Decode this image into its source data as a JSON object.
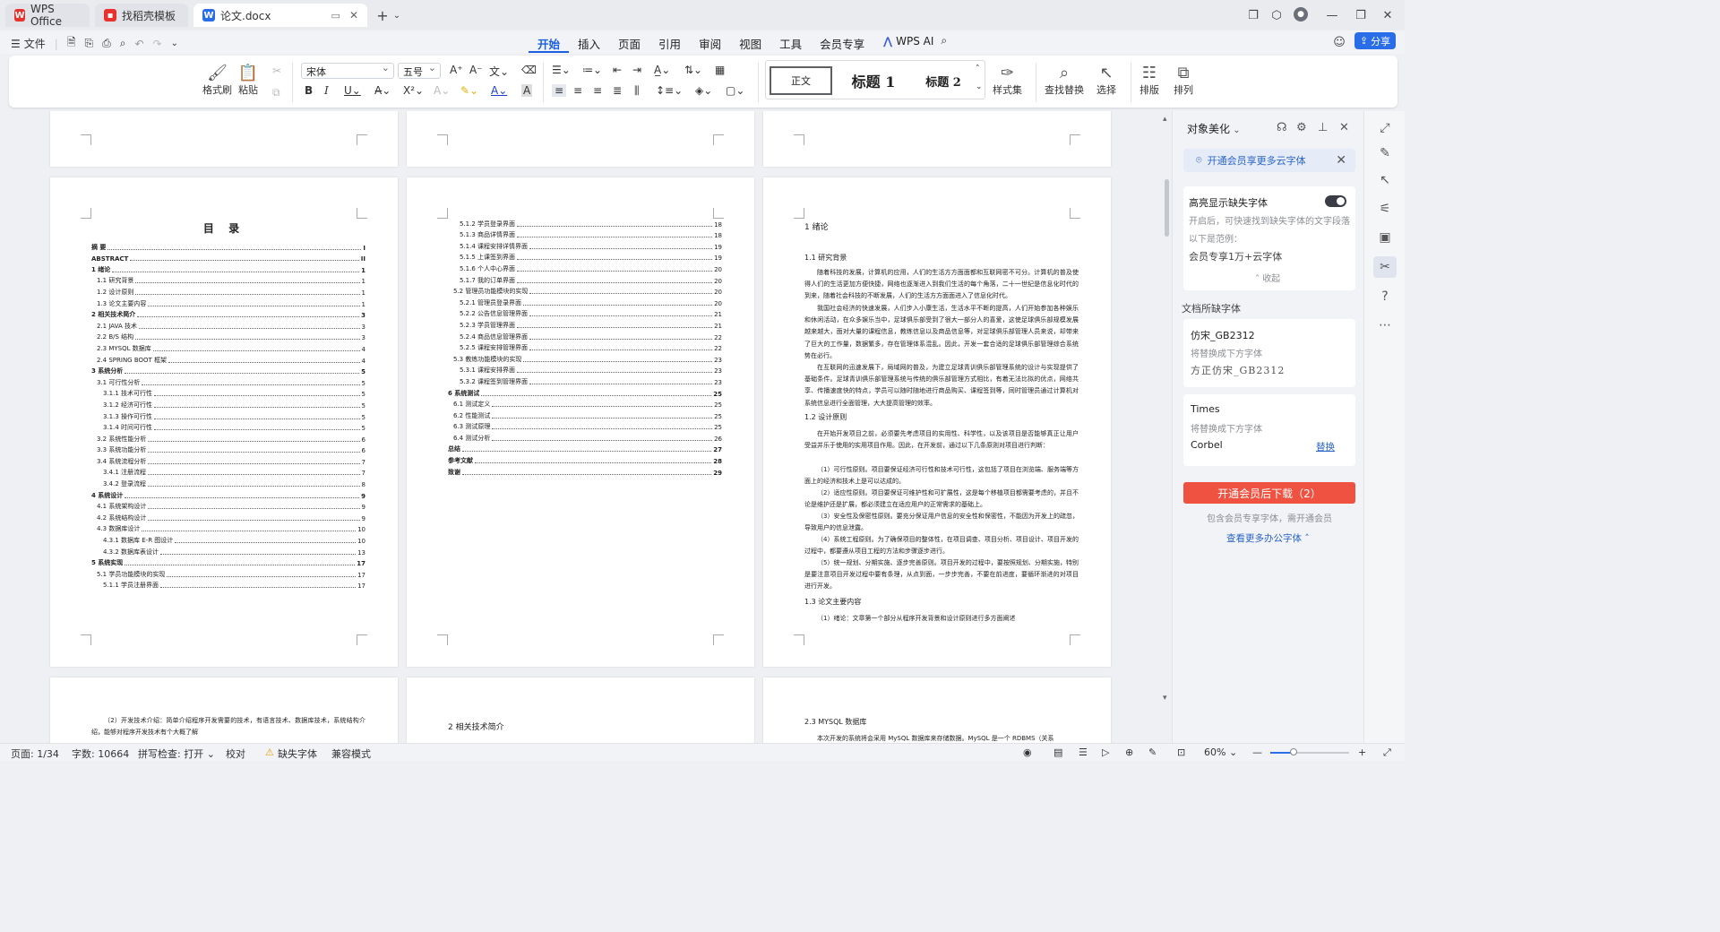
{
  "tabs": [
    {
      "label": "WPS Office",
      "icon": "wps-logo-icon"
    },
    {
      "label": "找稻壳模板",
      "icon": "docer-logo-icon"
    },
    {
      "label": "论文.docx",
      "icon": "writer-doc-icon"
    }
  ],
  "menu": {
    "file": "文件",
    "tabs": [
      "开始",
      "插入",
      "页面",
      "引用",
      "审阅",
      "视图",
      "工具",
      "会员专享"
    ],
    "active_tab": "开始",
    "wps_ai": "WPS AI",
    "share": "分享"
  },
  "ribbon": {
    "format_painter": "格式刷",
    "paste": "粘贴",
    "font_name": "宋体",
    "font_size": "五号",
    "style_normal": "正文",
    "style_h1": "标题 1",
    "style_h2": "标题 2",
    "style_set": "样式集",
    "find_replace": "查找替换",
    "select": "选择",
    "layout": "排版",
    "arrange": "排列"
  },
  "toc_page1": {
    "title": "目 录",
    "rows": [
      {
        "level": 1,
        "label": "摘 要",
        "page": "I"
      },
      {
        "level": 1,
        "label": "ABSTRACT",
        "page": "II"
      },
      {
        "level": 1,
        "label": "1 绪论",
        "page": "1"
      },
      {
        "level": 2,
        "label": "1.1 研究背景",
        "page": "1"
      },
      {
        "level": 2,
        "label": "1.2 设计原则",
        "page": "1"
      },
      {
        "level": 2,
        "label": "1.3 论文主要内容",
        "page": "1"
      },
      {
        "level": 1,
        "label": "2 相关技术简介",
        "page": "3"
      },
      {
        "level": 2,
        "label": "2.1 JAVA 技术",
        "page": "3"
      },
      {
        "level": 2,
        "label": "2.2 B/S 结构",
        "page": "3"
      },
      {
        "level": 2,
        "label": "2.3 MYSQL 数据库",
        "page": "4"
      },
      {
        "level": 2,
        "label": "2.4 SPRING BOOT 框架",
        "page": "4"
      },
      {
        "level": 1,
        "label": "3 系统分析",
        "page": "5"
      },
      {
        "level": 2,
        "label": "3.1 可行性分析",
        "page": "5"
      },
      {
        "level": 3,
        "label": "3.1.1 技术可行性",
        "page": "5"
      },
      {
        "level": 3,
        "label": "3.1.2 经济可行性",
        "page": "5"
      },
      {
        "level": 3,
        "label": "3.1.3 操作可行性",
        "page": "5"
      },
      {
        "level": 3,
        "label": "3.1.4 时间可行性",
        "page": "5"
      },
      {
        "level": 2,
        "label": "3.2 系统性能分析",
        "page": "6"
      },
      {
        "level": 2,
        "label": "3.3 系统功能分析",
        "page": "6"
      },
      {
        "level": 2,
        "label": "3.4 系统流程分析",
        "page": "7"
      },
      {
        "level": 3,
        "label": "3.4.1 注册流程",
        "page": "7"
      },
      {
        "level": 3,
        "label": "3.4.2 登录流程",
        "page": "8"
      },
      {
        "level": 1,
        "label": "4 系统设计",
        "page": "9"
      },
      {
        "level": 2,
        "label": "4.1 系统架构设计",
        "page": "9"
      },
      {
        "level": 2,
        "label": "4.2 系统结构设计",
        "page": "9"
      },
      {
        "level": 2,
        "label": "4.3 数据库设计",
        "page": "10"
      },
      {
        "level": 3,
        "label": "4.3.1 数据库 E-R 图设计",
        "page": "10"
      },
      {
        "level": 3,
        "label": "4.3.2 数据库表设计",
        "page": "13"
      },
      {
        "level": 1,
        "label": "5 系统实现",
        "page": "17"
      },
      {
        "level": 2,
        "label": "5.1 学员功能模块的实现",
        "page": "17"
      },
      {
        "level": 3,
        "label": "5.1.1 学员注册界面",
        "page": "17"
      }
    ]
  },
  "toc_page2": {
    "rows": [
      {
        "level": 3,
        "label": "5.1.2 学员登录界面",
        "page": "18"
      },
      {
        "level": 3,
        "label": "5.1.3 商品详情界面",
        "page": "18"
      },
      {
        "level": 3,
        "label": "5.1.4 课程安排详情界面",
        "page": "19"
      },
      {
        "level": 3,
        "label": "5.1.5 上课签到界面",
        "page": "19"
      },
      {
        "level": 3,
        "label": "5.1.6 个人中心界面",
        "page": "20"
      },
      {
        "level": 3,
        "label": "5.1.7 我的订单界面",
        "page": "20"
      },
      {
        "level": 2,
        "label": "5.2 管理员功能模块的实现",
        "page": "20"
      },
      {
        "level": 3,
        "label": "5.2.1 管理员登录界面",
        "page": "20"
      },
      {
        "level": 3,
        "label": "5.2.2 公告信息管理界面",
        "page": "21"
      },
      {
        "level": 3,
        "label": "5.2.3 学员管理界面",
        "page": "21"
      },
      {
        "level": 3,
        "label": "5.2.4 商品信息管理界面",
        "page": "22"
      },
      {
        "level": 3,
        "label": "5.2.5 课程安排管理界面",
        "page": "22"
      },
      {
        "level": 2,
        "label": "5.3 教练功能模块的实现",
        "page": "23"
      },
      {
        "level": 3,
        "label": "5.3.1 课程安排界面",
        "page": "23"
      },
      {
        "level": 3,
        "label": "5.3.2 课程签到管理界面",
        "page": "23"
      },
      {
        "level": 1,
        "label": "6 系统测试",
        "page": "25"
      },
      {
        "level": 2,
        "label": "6.1 测试定义",
        "page": "25"
      },
      {
        "level": 2,
        "label": "6.2 性能测试",
        "page": "25"
      },
      {
        "level": 2,
        "label": "6.3 测试原理",
        "page": "25"
      },
      {
        "level": 2,
        "label": "6.4 测试分析",
        "page": "26"
      },
      {
        "level": 1,
        "label": "总结",
        "page": "27"
      },
      {
        "level": 1,
        "label": "参考文献",
        "page": "28"
      },
      {
        "level": 1,
        "label": "致谢",
        "page": "29"
      }
    ]
  },
  "page3": {
    "chapter": "1 绪论",
    "h_1_1": "1.1 研究背景",
    "p1": "随着科技的发展，计算机的应用，人们的生活方方面面都和互联网密不可分。计算机的普及使得人们的生活更加方便快捷，网络也逐渐进入到我们生活的每个角落，二十一世纪是信息化时代的到来，随着社会科技的不断发展，人们的生活方方面面进入了信息化时代。",
    "p2": "我国社会经济的快速发展，人们步入小康生活，生活水平不断的提高，人们开始参加各种娱乐和休闲活动，在众多娱乐当中，足球俱乐部受到了很大一部分人的喜爱，这使足球俱乐部规模发展越来越大，面对大量的课程信息，教练信息以及商品信息等，对足球俱乐部管理人员来说，却带来了巨大的工作量，数据繁多，存在管理体系混乱。因此，开发一套合适的足球俱乐部管理综合系统势在必行。",
    "p3": "在互联网的迅速发展下，局域网的普及，为建立足球青训俱乐部管理系统的设计与实现提供了基础条件。足球青训俱乐部管理系统与传统的俱乐部管理方式相比，有着无法比拟的优点，网络共享、传播速度快的特点，学员可以随时随地进行商品购买、课程签到等，同时管理员通过计算机对系统信息进行全面管理，大大提高管理的效率。",
    "h_1_2": "1.2 设计原则",
    "p4": "在开始开发项目之前，必须要先考虑项目的实用性、科学性，以及该项目是否能够真正让用户受益并乐于使用的实用项目作用。因此，在开发前，通过以下几条原则对项目进行判断：",
    "p5": "（1）可行性原则。项目要保证经济可行性和技术可行性，这包括了项目在浏览端、服务端等方面上的经济和技术上是可以达成的。",
    "p6": "（2）适应性原则。项目要保证可维护性和可扩展性，这是每个移植项目都需要考虑的，并且不论是维护还是扩展，都必须建立在适应用户的正常需求的基础上。",
    "p7": "（3）安全性及保密性原则。要充分保证用户信息的安全性和保密性，不能因为开发上的疏忽，导致用户的信息泄露。",
    "p8": "（4）系统工程原则。为了确保项目的整体性，在项目调查、项目分析、项目设计、项目开发的过程中，都要遵从项目工程的方法和步骤逐步进行。",
    "p9": "（5）统一规划、分期实施、逐步完善原则。项目开发的过程中，要按照规划、分期实施，特别是要注意项目开发过程中要有条理，从点到面，一步步完善，不要在前进度，要循环渐进的对项目进行开发。",
    "h_1_3": "1.3 论文主要内容",
    "p10": "（1）绪论：文章第一个部分从程序开发背景和设计原则进行多方面阐述"
  },
  "page4": {
    "p1": "（2）开发技术介绍：简单介绍程序开发需要的技术，有语言技术、数据库技术，系统结构介绍，能够对程序开发技术有个大概了解"
  },
  "page5": {
    "chapter": "2 相关技术简介"
  },
  "page6": {
    "section": "2.3 MYSQL 数据库",
    "p1": "本次开发的系统将会采用 MySQL 数据库来存储数据。MySQL 是一个 RDBMS（关系"
  },
  "sidebar": {
    "title": "对象美化",
    "promo": "开通会员享更多云字体",
    "highlight_title": "高亮显示缺失字体",
    "highlight_desc": "开启后，可快速找到缺失字体的文字段落",
    "example_label": "以下是范例：",
    "example_value": "会员专享1万+云字体",
    "collapse": "收起",
    "missing_label": "文档所缺字体",
    "font1_name": "仿宋_GB2312",
    "font1_replace": "将替换成下方字体",
    "font1_target": "方正仿宋_GB2312",
    "font2_name": "Times",
    "font2_replace": "将替换成下方字体",
    "font2_target": "Corbel",
    "font2_action": "替换",
    "download_btn": "开通会员后下载（2）",
    "member_note": "包含会员专享字体，需开通会员",
    "more_link": "查看更多办公字体"
  },
  "statusbar": {
    "page": "页面: 1/34",
    "words": "字数: 10664",
    "spell": "拼写检查: 打开",
    "proof": "校对",
    "missing_font": "缺失字体",
    "compat": "兼容模式",
    "zoom": "60%",
    "zoom_level": 0.3
  }
}
